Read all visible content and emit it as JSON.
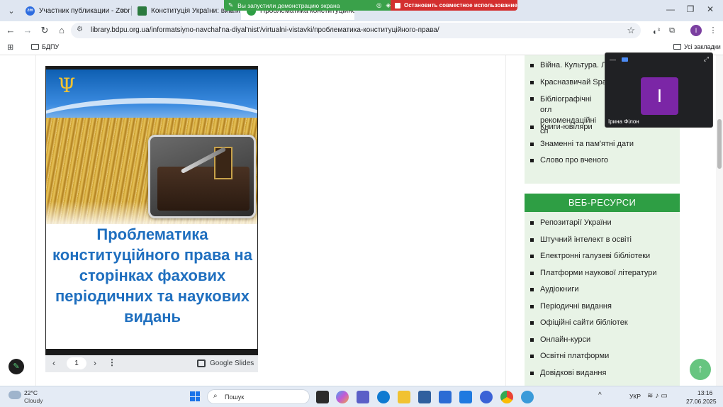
{
  "browser": {
    "tabs": [
      {
        "title": "Участник публикации - Zoom",
        "favicon_color": "#2d6cdf",
        "favicon_text": "zm"
      },
      {
        "title": "Конституція України: виклики",
        "favicon_color": "#2b7a3e",
        "favicon_text": ""
      },
      {
        "title": "Проблематика конституційно",
        "favicon_color": "#2e9e44",
        "favicon_text": ""
      }
    ],
    "url": "library.bdpu.org.ua/informatsiyno-navchal'na-diyal'nist'/virtualni-vistavki/проблематика-конституційного-права/",
    "profile_initial": "I",
    "extension_badge": "3",
    "bookmarks": {
      "folder": "БДПУ",
      "all": "Усі закладки"
    }
  },
  "share_banner": {
    "status": "Вы запустили демонстрацию экрана",
    "stop_label": "Остановить совместное использование",
    "ok_color": "#3aa14a",
    "stop_color": "#d32f2f"
  },
  "slide": {
    "title": "Проблематика конституційного права на сторінках фахових періодичних  та наукових видань",
    "page": "1",
    "provider": "Google Slides"
  },
  "sidebar": {
    "top_list": [
      "Війна. Культура. Л",
      "Красназвичай Spac",
      "Бібліографічні огл рекомендаційні сп",
      "Книги-ювіляри",
      "Знаменні та пам'ятні дати",
      "Слово про вченого"
    ],
    "web_heading": "ВЕБ-РЕСУРСИ",
    "web_list": [
      "Репозитарії України",
      "Штучний інтелект в освіті",
      "Електронні галузеві бібліотеки",
      "Платформи наукової літератури",
      "Аудіокниги",
      "Періодичні видання",
      "Офіційні сайти бібліотек",
      "Онлайн-курси",
      "Освітні платформи",
      "Довідкові видання"
    ],
    "accent": "#2e9e44",
    "panel_bg": "#e8f3e6"
  },
  "meeting": {
    "participant": "Ірина Філон",
    "initial": "I",
    "avatar_color": "#7b26a6"
  },
  "taskbar": {
    "temp": "22°C",
    "weather": "Cloudy",
    "search_placeholder": "Пошук",
    "lang": "УКР",
    "time": "13:16",
    "date": "27.06.2025"
  }
}
